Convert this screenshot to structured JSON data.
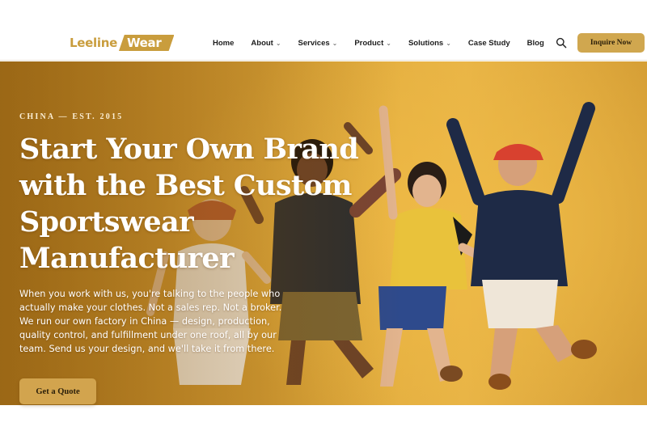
{
  "brand": {
    "logo_part1": "Leeline",
    "logo_part2": "Wear",
    "accent_color": "#c99d3d"
  },
  "nav": {
    "items": [
      {
        "label": "Home",
        "has_dropdown": false
      },
      {
        "label": "About",
        "has_dropdown": true
      },
      {
        "label": "Services",
        "has_dropdown": true
      },
      {
        "label": "Product",
        "has_dropdown": true
      },
      {
        "label": "Solutions",
        "has_dropdown": true
      },
      {
        "label": "Case Study",
        "has_dropdown": false
      },
      {
        "label": "Blog",
        "has_dropdown": false
      }
    ],
    "dropdown_glyph": "⌄",
    "search_icon": "search-icon",
    "inquire_label": "Inquire Now"
  },
  "hero": {
    "eyebrow": "CHINA — EST. 2015",
    "headline": "Start Your Own Brand with the Best Custom Sportswear Manufacturer",
    "lede": "When you work with us, you're talking to the people who actually make your clothes. Not a sales rep. Not a broker. We run our own factory in China — design, production, quality control, and fulfillment under one roof, all by our team. Send us your design, and we'll take it from there.",
    "cta_label": "Get a Quote",
    "background_color": "#e1ab3c"
  }
}
